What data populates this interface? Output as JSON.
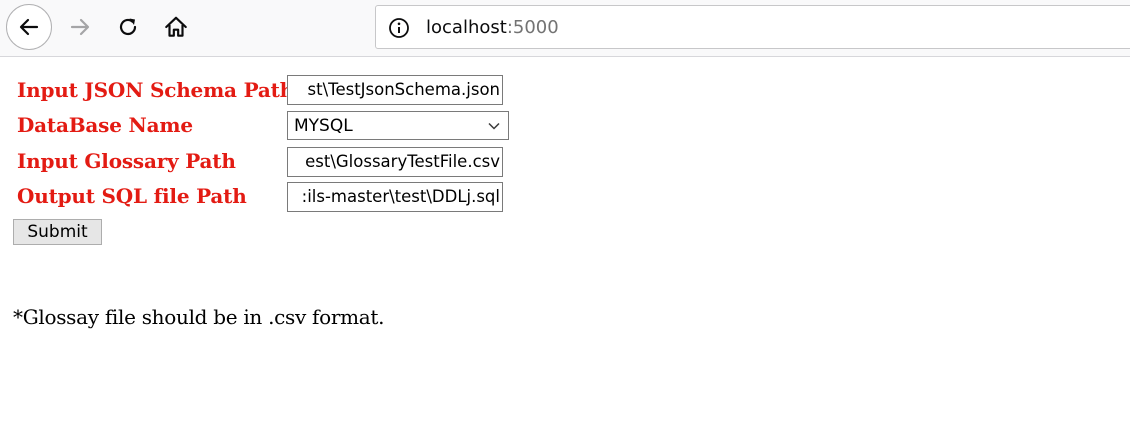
{
  "browser": {
    "url_host": "localhost",
    "url_port": ":5000",
    "icons": {
      "back": "back-arrow-icon",
      "forward": "forward-arrow-icon",
      "reload": "reload-icon",
      "home": "home-icon",
      "info": "info-icon"
    }
  },
  "form": {
    "schema_label": "Input JSON Schema Path",
    "schema_value": "st\\TestJsonSchema.json",
    "database_label": "DataBase Name",
    "database_selected": "MYSQL",
    "glossary_label": "Input Glossary Path",
    "glossary_value": "est\\GlossaryTestFile.csv",
    "output_label": "Output SQL file Path",
    "output_value": ":ils-master\\test\\DDLj.sql",
    "submit_label": "Submit"
  },
  "note": "*Glossay file should be in .csv format.",
  "colors": {
    "label_red": "#e31b13",
    "toolbar_bg": "#f9f9fa"
  }
}
